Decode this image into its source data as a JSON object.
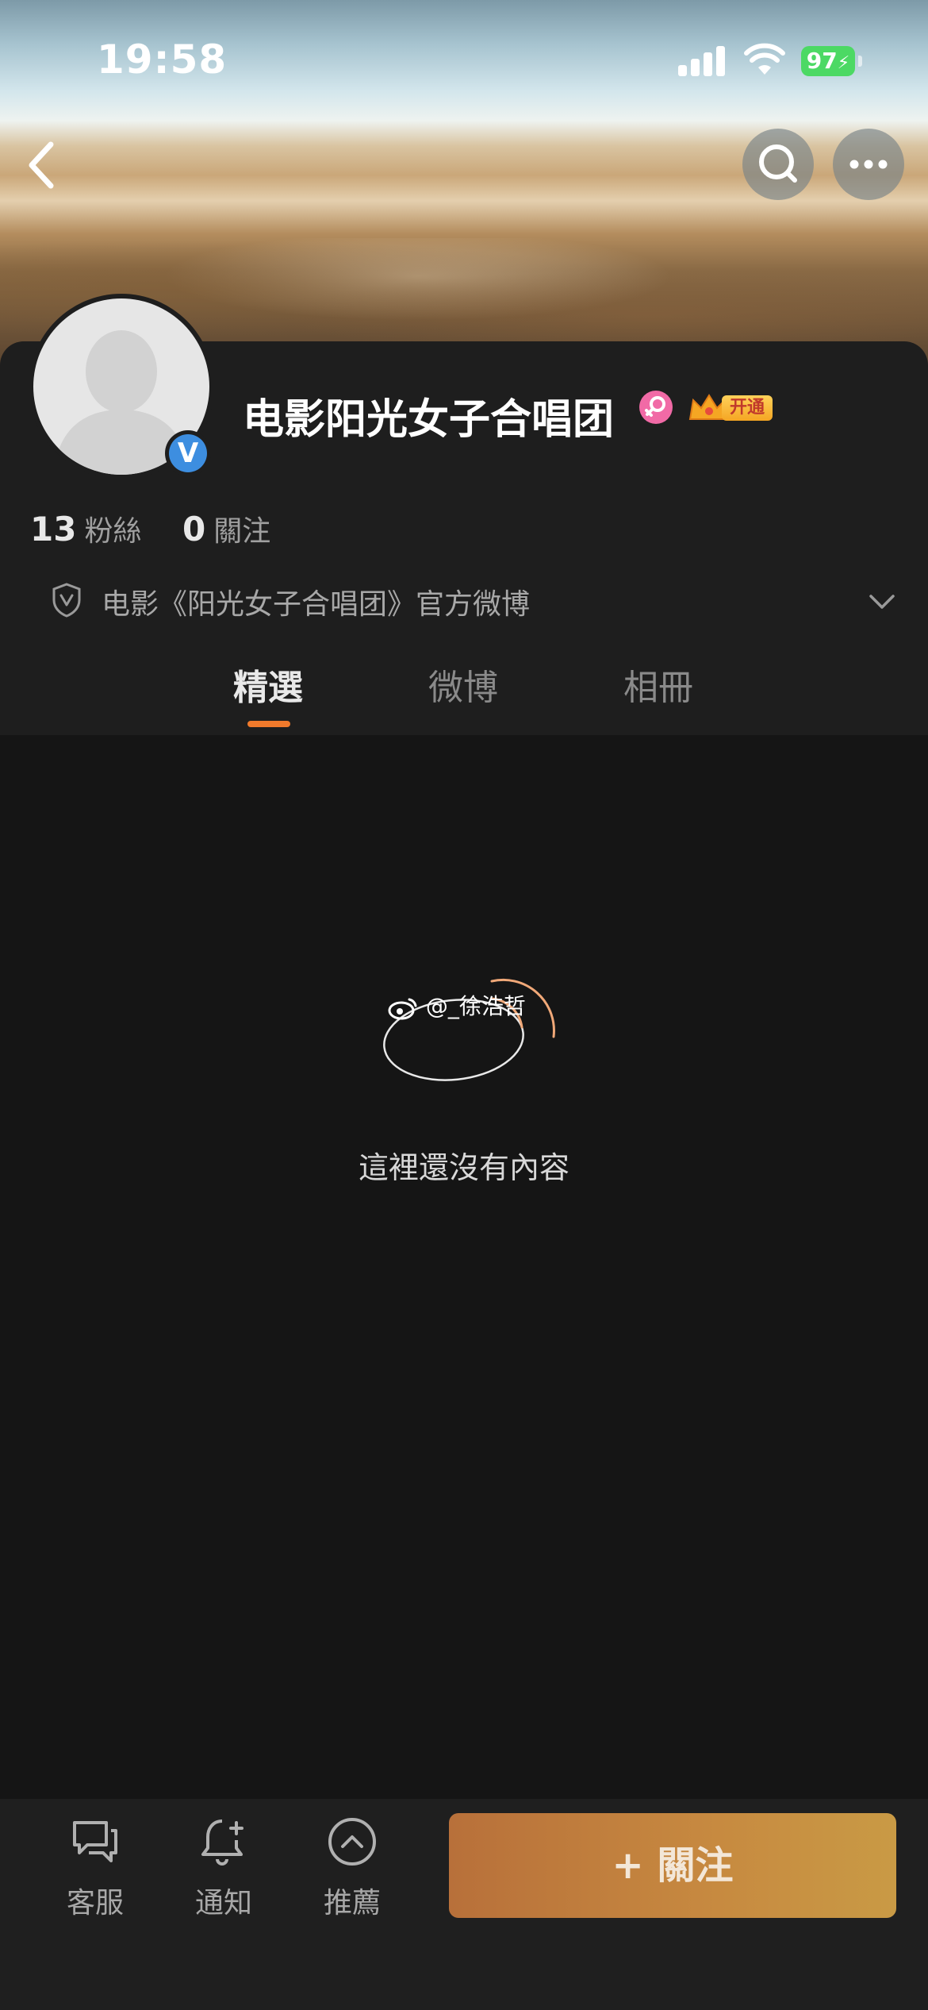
{
  "status_bar": {
    "time": "19:58",
    "battery": "97"
  },
  "profile": {
    "name": "电影阳光女子合唱团",
    "vip_label": "开通",
    "verified_badge": "V",
    "stats": [
      {
        "count": "13",
        "label": "粉絲"
      },
      {
        "count": "0",
        "label": "關注"
      }
    ],
    "intro": "电影《阳光女子合唱团》官方微博"
  },
  "tabs": [
    {
      "label": "精選",
      "active": true
    },
    {
      "label": "微博",
      "active": false
    },
    {
      "label": "相冊",
      "active": false
    }
  ],
  "empty_state": {
    "watermark": "@_徐浩哲",
    "message": "這裡還沒有內容"
  },
  "bottom_bar": {
    "items": [
      {
        "label": "客服",
        "icon": "chat-icon"
      },
      {
        "label": "通知",
        "icon": "bell-plus-icon"
      },
      {
        "label": "推薦",
        "icon": "chevron-up-circle-icon"
      }
    ],
    "follow_label": "+ 關注"
  },
  "colors": {
    "background": "#151515",
    "panel": "#1e1e1e",
    "accent_orange": "#f07a2c",
    "verified_blue": "#3d8ee0",
    "battery_green": "#4cd964",
    "follow_gradient_start": "#b8703a",
    "follow_gradient_end": "#c99a45"
  }
}
